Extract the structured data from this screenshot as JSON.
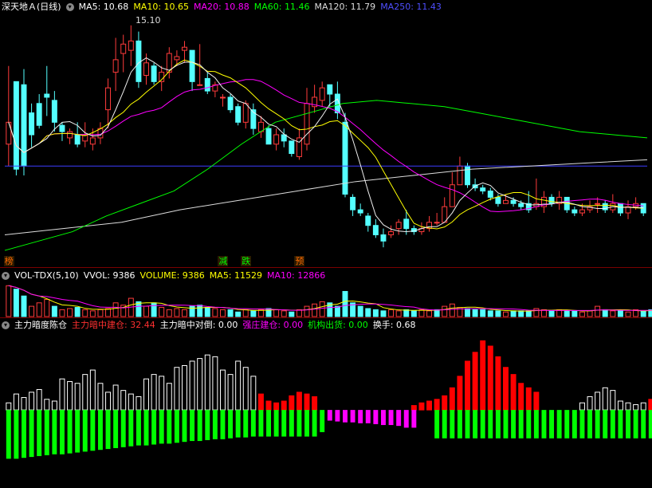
{
  "colors": {
    "up": "#ff3b3b",
    "down": "#54ffff",
    "ma5": "#f0f0f0",
    "ma10": "#ffff00",
    "ma20": "#ff00ff",
    "ma60": "#00ff00",
    "ma120": "#dcdcdc",
    "ma250": "#3c3cff",
    "vol_ma5": "#ffff00",
    "vol_ma10": "#ff00ff",
    "green": "#00ff00",
    "magenta": "#ff00ff",
    "white": "#ffffff",
    "red": "#ff0000"
  },
  "main_header": {
    "title": "深天地Ａ(日线)",
    "ma5": "MA5: 10.68",
    "ma10": "MA10: 10.65",
    "ma20": "MA20: 10.88",
    "ma60": "MA60: 11.46",
    "ma120": "MA120: 11.79",
    "ma250": "MA250: 11.43"
  },
  "peak_label": "15.10",
  "signals": [
    {
      "text": "榜",
      "i": 0,
      "color": "#ff6a00"
    },
    {
      "text": "减",
      "i": 28,
      "color": "#00ff00"
    },
    {
      "text": "跌",
      "i": 31,
      "color": "#00ff00"
    },
    {
      "text": "预",
      "i": 38,
      "color": "#ff6a00"
    }
  ],
  "vol_header": {
    "name": "VOL-TDX(5,10)",
    "vvol": "VVOL: 9386",
    "volume": "VOLUME: 9386",
    "ma5": "MA5: 11529",
    "ma10": "MA10: 12866"
  },
  "ind_header": {
    "name": "主力暗度陈仓",
    "a": "主力暗中建仓: 32.44",
    "b": "主力暗中对倒: 0.00",
    "c": "强庄建仓: 0.00",
    "d": "机构出货: 0.00",
    "e": "换手: 0.68"
  },
  "chart_data": [
    {
      "type": "candlestick",
      "title": "深天地Ａ(日线)",
      "ylim": [
        7.8,
        15.4
      ],
      "candles": [
        [
          11.3,
          11.3,
          12.0,
          13.8,
          10.6
        ],
        [
          13.3,
          13.0,
          10.5,
          12.6,
          10.3
        ],
        [
          13.2,
          12.3,
          10.6,
          13.7,
          10.3
        ],
        [
          12.3,
          12.3,
          11.6,
          12.6,
          11.2
        ],
        [
          12.6,
          12.4,
          11.9,
          12.9,
          11.8
        ],
        [
          12.9,
          12.4,
          12.8,
          13.8,
          12.2
        ],
        [
          12.7,
          12.4,
          12.0,
          13.0,
          11.7
        ],
        [
          11.9,
          11.5,
          11.7,
          12.0,
          11.4
        ],
        [
          11.5,
          11.4,
          11.7,
          11.8,
          11.3
        ],
        [
          11.6,
          11.8,
          11.3,
          12.0,
          11.2
        ],
        [
          11.4,
          11.4,
          11.6,
          12.0,
          11.2
        ],
        [
          11.3,
          11.2,
          11.5,
          11.8,
          11.1
        ],
        [
          11.5,
          11.4,
          11.8,
          12.0,
          11.3
        ],
        [
          12.4,
          11.9,
          13.1,
          13.4,
          11.8
        ],
        [
          13.6,
          13.2,
          14.0,
          14.7,
          13.0
        ],
        [
          14.2,
          13.9,
          14.5,
          14.8,
          13.6
        ],
        [
          14.3,
          14.0,
          14.6,
          15.1,
          13.8
        ],
        [
          14.6,
          14.6,
          13.3,
          14.9,
          13.1
        ],
        [
          13.5,
          13.4,
          13.9,
          14.2,
          13.2
        ],
        [
          13.8,
          13.6,
          13.3,
          13.9,
          13.2
        ],
        [
          13.3,
          13.2,
          13.6,
          13.8,
          13.0
        ],
        [
          13.6,
          13.6,
          14.2,
          14.4,
          13.4
        ],
        [
          14.0,
          13.9,
          14.1,
          14.3,
          13.8
        ],
        [
          14.3,
          14.1,
          14.4,
          14.6,
          13.9
        ],
        [
          14.3,
          13.8,
          13.3,
          14.3,
          13.0
        ],
        [
          13.2,
          13.4,
          13.2,
          14.5,
          13.2
        ],
        [
          13.4,
          13.4,
          13.0,
          13.6,
          12.9
        ],
        [
          13.0,
          12.9,
          13.2,
          13.3,
          12.8
        ],
        [
          12.8,
          12.6,
          12.8,
          12.9,
          12.5
        ],
        [
          12.8,
          12.7,
          12.4,
          12.9,
          12.3
        ],
        [
          12.5,
          12.4,
          12.0,
          12.6,
          11.9
        ],
        [
          12.0,
          11.9,
          12.6,
          12.7,
          11.8
        ],
        [
          12.4,
          12.2,
          11.8,
          12.6,
          11.6
        ],
        [
          11.7,
          11.7,
          12.0,
          12.2,
          11.5
        ],
        [
          11.8,
          11.7,
          11.3,
          11.9,
          11.3
        ],
        [
          11.3,
          11.3,
          11.6,
          11.8,
          11.1
        ],
        [
          11.6,
          11.3,
          11.4,
          11.8,
          11.2
        ],
        [
          11.4,
          11.3,
          11.0,
          11.4,
          10.9
        ],
        [
          10.9,
          10.9,
          11.5,
          11.8,
          10.8
        ],
        [
          11.3,
          11.3,
          12.6,
          13.1,
          11.1
        ],
        [
          12.5,
          12.4,
          12.8,
          13.2,
          12.3
        ],
        [
          12.7,
          12.6,
          13.1,
          13.3,
          12.5
        ],
        [
          13.2,
          12.8,
          12.9,
          13.2,
          12.5
        ],
        [
          12.9,
          12.8,
          12.3,
          13.3,
          12.1
        ],
        [
          12.0,
          12.0,
          9.7,
          12.3,
          9.6
        ],
        [
          9.6,
          9.4,
          9.2,
          9.7,
          9.0
        ],
        [
          9.2,
          9.2,
          9.1,
          9.4,
          9.0
        ],
        [
          9.0,
          8.9,
          8.7,
          9.1,
          8.5
        ],
        [
          8.7,
          8.6,
          8.4,
          8.9,
          8.3
        ],
        [
          8.4,
          8.4,
          8.2,
          8.6,
          8.0
        ],
        [
          8.4,
          8.4,
          8.5,
          8.7,
          8.3
        ],
        [
          8.6,
          8.5,
          8.8,
          8.9,
          8.4
        ],
        [
          8.9,
          8.5,
          8.6,
          9.2,
          8.4
        ],
        [
          8.6,
          8.6,
          8.5,
          8.7,
          8.4
        ],
        [
          8.5,
          8.6,
          8.6,
          8.8,
          8.4
        ],
        [
          8.6,
          8.7,
          8.8,
          9.0,
          8.5
        ],
        [
          8.8,
          8.8,
          8.8,
          9.1,
          8.7
        ],
        [
          8.8,
          9.0,
          9.3,
          9.6,
          8.9
        ],
        [
          9.3,
          9.4,
          10.0,
          10.4,
          9.3
        ],
        [
          10.0,
          10.1,
          10.6,
          10.9,
          10.0
        ],
        [
          10.6,
          10.3,
          10.0,
          10.7,
          9.9
        ],
        [
          10.0,
          9.9,
          9.9,
          10.2,
          9.8
        ],
        [
          9.9,
          9.8,
          9.8,
          10.0,
          9.7
        ],
        [
          9.8,
          9.7,
          9.6,
          9.9,
          9.5
        ],
        [
          9.6,
          9.7,
          9.4,
          9.7,
          9.3
        ],
        [
          9.4,
          9.5,
          9.5,
          9.7,
          9.4
        ],
        [
          9.5,
          9.6,
          9.4,
          9.6,
          9.3
        ],
        [
          9.4,
          9.3,
          9.3,
          9.5,
          9.2
        ],
        [
          9.4,
          9.3,
          9.2,
          9.8,
          9.1
        ],
        [
          9.3,
          9.3,
          9.4,
          10.2,
          9.2
        ],
        [
          9.3,
          9.2,
          9.6,
          9.8,
          9.1
        ],
        [
          9.6,
          9.5,
          9.4,
          9.7,
          9.3
        ],
        [
          9.4,
          9.3,
          9.6,
          9.8,
          9.2
        ],
        [
          9.6,
          9.4,
          9.2,
          9.6,
          9.1
        ],
        [
          9.2,
          9.1,
          9.1,
          9.3,
          9.0
        ],
        [
          9.1,
          9.1,
          9.2,
          9.4,
          9.0
        ],
        [
          9.2,
          9.3,
          9.3,
          9.5,
          9.1
        ],
        [
          9.4,
          9.2,
          9.4,
          9.6,
          9.1
        ],
        [
          9.4,
          9.3,
          9.2,
          9.5,
          9.1
        ],
        [
          9.2,
          9.2,
          9.4,
          9.7,
          9.1
        ],
        [
          9.4,
          9.3,
          9.1,
          9.4,
          9.0
        ],
        [
          9.1,
          9.0,
          9.3,
          9.5,
          8.9
        ],
        [
          9.3,
          9.2,
          9.4,
          9.6,
          9.2
        ],
        [
          9.4,
          9.3,
          9.1,
          9.4,
          9.0
        ]
      ],
      "ma120": [
        8.4,
        8.6,
        8.8,
        9.2,
        9.5,
        9.8,
        10.1,
        10.3,
        10.5,
        10.6,
        10.7,
        10.8
      ],
      "ma250": [
        10.6,
        10.6,
        10.6,
        10.6,
        10.6,
        10.6,
        10.6,
        10.6,
        10.6,
        10.6,
        10.6,
        10.6
      ],
      "ma60": [
        7.9,
        8.2,
        8.5,
        9.0,
        9.4,
        9.8,
        10.5,
        11.3,
        12.0,
        12.3,
        12.6,
        12.7,
        12.6,
        12.5,
        12.3,
        12.1,
        11.9,
        11.7,
        11.6,
        11.5
      ]
    },
    {
      "type": "bar",
      "title": "VOL-TDX(5,10)",
      "ylim": [
        0,
        30000
      ],
      "values": [
        27000,
        24000,
        18000,
        9000,
        12000,
        15000,
        9000,
        6000,
        7000,
        8000,
        6000,
        5000,
        6000,
        7000,
        12000,
        10000,
        16000,
        13000,
        9000,
        12000,
        8000,
        6000,
        7000,
        6000,
        9000,
        10000,
        8000,
        7000,
        6000,
        6000,
        4000,
        6000,
        5000,
        6000,
        7000,
        6000,
        5000,
        4000,
        6000,
        9000,
        11000,
        13000,
        12000,
        9000,
        22000,
        12000,
        9000,
        7000,
        6000,
        5000,
        6000,
        5000,
        6000,
        5000,
        6000,
        5000,
        6000,
        9000,
        11000,
        8000,
        7000,
        6000,
        6000,
        5000,
        5000,
        4000,
        5000,
        5000,
        5000,
        7000,
        6000,
        5000,
        6000,
        5000,
        5000,
        4000,
        5000,
        9000,
        6000,
        5000,
        5000,
        4000,
        6000,
        5000,
        6000,
        9386
      ],
      "up_mask": [
        1,
        0,
        0,
        1,
        1,
        1,
        0,
        1,
        1,
        0,
        1,
        1,
        1,
        1,
        1,
        1,
        1,
        0,
        1,
        0,
        1,
        1,
        1,
        1,
        0,
        0,
        0,
        1,
        1,
        0,
        0,
        1,
        0,
        1,
        0,
        1,
        1,
        0,
        1,
        1,
        1,
        1,
        0,
        0,
        0,
        0,
        0,
        0,
        0,
        0,
        1,
        1,
        0,
        0,
        1,
        1,
        0,
        1,
        1,
        1,
        0,
        0,
        0,
        0,
        0,
        1,
        0,
        0,
        0,
        1,
        1,
        0,
        1,
        0,
        0,
        1,
        1,
        1,
        0,
        1,
        0,
        1,
        1,
        0,
        0,
        1
      ]
    },
    {
      "type": "bar",
      "title": "主力暗度陈仓",
      "ylim": [
        -70,
        90
      ],
      "positive": [
        8,
        18,
        14,
        20,
        23,
        12,
        10,
        35,
        32,
        30,
        40,
        45,
        30,
        20,
        28,
        22,
        18,
        15,
        35,
        40,
        38,
        30,
        48,
        50,
        55,
        58,
        62,
        60,
        45,
        40,
        55,
        48,
        38,
        18,
        10,
        8,
        10,
        16,
        20,
        18,
        15,
        0,
        0,
        0,
        0,
        0,
        0,
        0,
        0,
        0,
        0,
        0,
        0,
        5,
        8,
        10,
        12,
        16,
        25,
        38,
        55,
        65,
        78,
        72,
        60,
        48,
        40,
        30,
        25,
        20,
        0,
        0,
        0,
        0,
        0,
        8,
        15,
        20,
        25,
        22,
        10,
        8,
        6,
        8,
        12,
        32.44
      ],
      "pos_color": [
        "w",
        "w",
        "w",
        "w",
        "w",
        "w",
        "w",
        "w",
        "w",
        "w",
        "w",
        "w",
        "w",
        "w",
        "w",
        "w",
        "w",
        "w",
        "w",
        "w",
        "w",
        "w",
        "w",
        "w",
        "w",
        "w",
        "w",
        "w",
        "w",
        "w",
        "w",
        "w",
        "w",
        "r",
        "r",
        "r",
        "r",
        "r",
        "r",
        "r",
        "r",
        "r",
        "r",
        "r",
        "r",
        "r",
        "r",
        "r",
        "r",
        "r",
        "r",
        "r",
        "r",
        "r",
        "r",
        "r",
        "r",
        "r",
        "r",
        "r",
        "r",
        "r",
        "r",
        "r",
        "r",
        "r",
        "r",
        "r",
        "r",
        "r",
        "w",
        "w",
        "w",
        "w",
        "w",
        "w",
        "w",
        "w",
        "w",
        "w",
        "w",
        "w",
        "w",
        "w",
        "r",
        "r"
      ],
      "negative": [
        -55,
        -55,
        -54,
        -53,
        -52,
        -51,
        -50,
        -50,
        -49,
        -48,
        -47,
        -46,
        -45,
        -44,
        -43,
        -42,
        -41,
        -40,
        -40,
        -39,
        -38,
        -38,
        -37,
        -36,
        -35,
        -35,
        -34,
        -33,
        -33,
        -32,
        -31,
        -31,
        -30,
        -30,
        -30,
        -30,
        -30,
        -30,
        -30,
        -30,
        -30,
        -25,
        -12,
        -13,
        -14,
        -14,
        -15,
        -15,
        -16,
        -17,
        -17,
        -18,
        -20,
        -20,
        0,
        0,
        -32,
        -32,
        -32,
        -32,
        -32,
        -32,
        -32,
        -32,
        -32,
        -32,
        -32,
        -32,
        -32,
        -32,
        -32,
        -32,
        -32,
        -32,
        -32,
        -32,
        -32,
        -32,
        -32,
        -32,
        -32,
        -32,
        -32,
        -32,
        -32,
        -32
      ],
      "neg_color": [
        "g",
        "g",
        "g",
        "g",
        "g",
        "g",
        "g",
        "g",
        "g",
        "g",
        "g",
        "g",
        "g",
        "g",
        "g",
        "g",
        "g",
        "g",
        "g",
        "g",
        "g",
        "g",
        "g",
        "g",
        "g",
        "g",
        "g",
        "g",
        "g",
        "g",
        "g",
        "g",
        "g",
        "g",
        "g",
        "g",
        "g",
        "g",
        "g",
        "g",
        "g",
        "g",
        "m",
        "m",
        "m",
        "m",
        "m",
        "m",
        "m",
        "m",
        "m",
        "m",
        "m",
        "m",
        "g",
        "g",
        "g",
        "g",
        "g",
        "g",
        "g",
        "g",
        "g",
        "g",
        "g",
        "g",
        "g",
        "g",
        "g",
        "g",
        "g",
        "g",
        "g",
        "g",
        "g",
        "g",
        "g",
        "g",
        "g",
        "g",
        "g",
        "g",
        "g",
        "g",
        "g",
        "g"
      ]
    }
  ]
}
